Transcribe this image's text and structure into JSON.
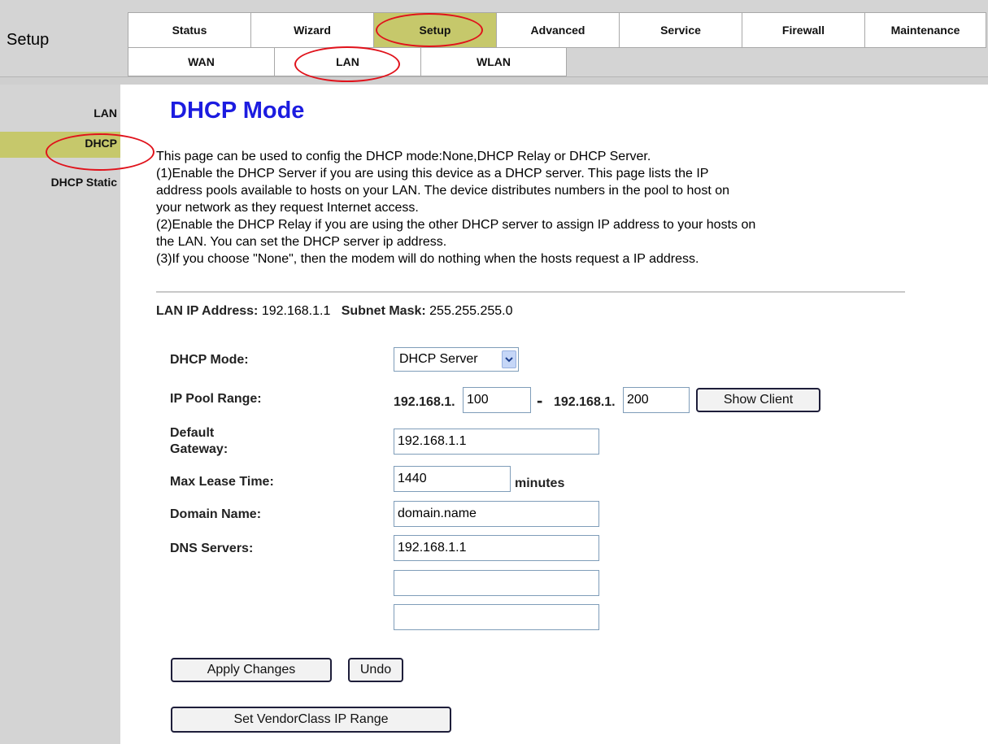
{
  "header": {
    "section_title": "Setup",
    "main_tabs": [
      {
        "label": "Status"
      },
      {
        "label": "Wizard"
      },
      {
        "label": "Setup"
      },
      {
        "label": "Advanced"
      },
      {
        "label": "Service"
      },
      {
        "label": "Firewall"
      },
      {
        "label": "Maintenance"
      }
    ],
    "sub_tabs": [
      {
        "label": "WAN"
      },
      {
        "label": "LAN"
      },
      {
        "label": "WLAN"
      }
    ],
    "active_color": "#c6c86b",
    "annotation_color": "#e0121b"
  },
  "sidebar": {
    "items": [
      {
        "label": "LAN"
      },
      {
        "label": "DHCP"
      },
      {
        "label": "DHCP Static"
      }
    ]
  },
  "main": {
    "title": "DHCP Mode",
    "title_color": "#1c1ce0",
    "description": [
      "This page can be used to config the DHCP mode:None,DHCP Relay or DHCP Server.",
      "(1)Enable the DHCP Server if you are using this device as a DHCP server. This page lists the IP",
      "address pools available to hosts on your LAN. The device distributes numbers in the pool to host on",
      "your network as they request Internet access.",
      "(2)Enable the DHCP Relay if you are using the other DHCP server to assign IP address to your hosts on",
      "the LAN. You can set the DHCP server ip address.",
      "(3)If you choose \"None\", then the modem will do nothing when the hosts request a IP address."
    ],
    "lan_ip_label": "LAN IP Address:",
    "lan_ip_value": "192.168.1.1",
    "subnet_label": "Subnet Mask:",
    "subnet_value": "255.255.255.0",
    "form": {
      "dhcp_mode_label": "DHCP Mode:",
      "dhcp_mode_value": "DHCP Server",
      "ip_pool_label": "IP Pool Range:",
      "pool_prefix": "192.168.1.",
      "pool_start": "100",
      "pool_separator": "-",
      "pool_end": "200",
      "show_client_label": "Show Client",
      "default_gateway_label_1": "Default",
      "default_gateway_label_2": "Gateway:",
      "default_gateway_value": "192.168.1.1",
      "max_lease_label": "Max Lease Time:",
      "max_lease_value": "1440",
      "max_lease_unit": "minutes",
      "domain_name_label": "Domain Name:",
      "domain_name_value": "domain.name",
      "dns_servers_label": "DNS Servers:",
      "dns_1": "192.168.1.1",
      "dns_2": "",
      "dns_3": ""
    },
    "buttons": {
      "apply": "Apply Changes",
      "undo": "Undo",
      "vendor_class": "Set VendorClass IP Range"
    }
  }
}
